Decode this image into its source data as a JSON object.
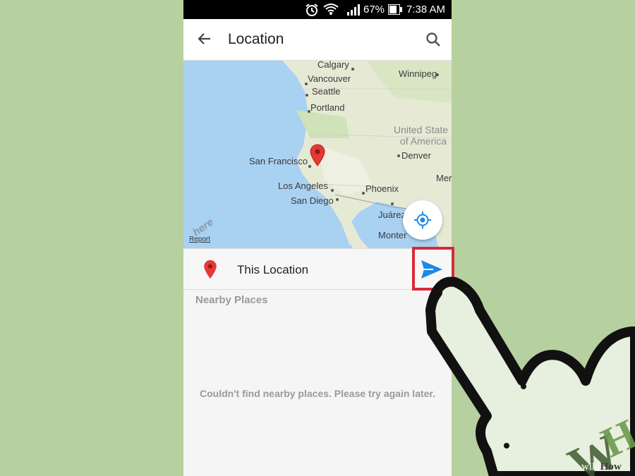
{
  "status_bar": {
    "battery": "67%",
    "time": "7:38 AM",
    "icons": [
      "alarm-icon",
      "wifi-icon",
      "signal-icon",
      "battery-icon"
    ]
  },
  "app_bar": {
    "title": "Location",
    "back_icon": "arrow-left-icon",
    "search_icon": "search-icon"
  },
  "map": {
    "cities": {
      "calgary": "Calgary",
      "vancouver": "Vancouver",
      "winnipeg": "Winnipeg",
      "seattle": "Seattle",
      "portland": "Portland",
      "usa_line1": "United State",
      "usa_line2": "of America",
      "denver": "Denver",
      "san_francisco": "San Francisco",
      "los_angeles": "Los Angeles",
      "phoenix": "Phoenix",
      "san_diego": "San Diego",
      "juarez": "Juárez",
      "monterrey": "Monter",
      "mer": "Mer"
    },
    "report_link": "Report",
    "logo_text": "here"
  },
  "location_row": {
    "label": "This Location",
    "pin_color": "#e53935",
    "send_color": "#1e88e5"
  },
  "nearby": {
    "title": "Nearby Places",
    "empty_message": "Couldn't find nearby places. Please try again later."
  },
  "highlight_color": "#d62b3b",
  "watermark": {
    "prefix": "wiki",
    "suffix": "How"
  }
}
